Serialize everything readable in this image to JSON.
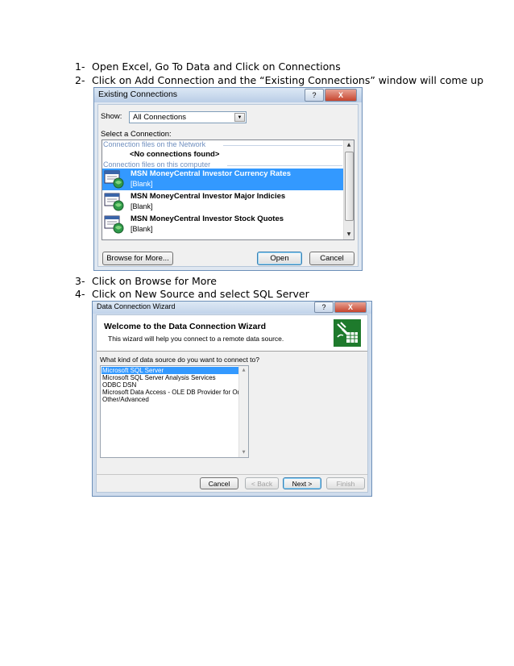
{
  "steps": [
    {
      "num": "1-",
      "text": "Open Excel, Go To Data and Click on Connections"
    },
    {
      "num": "2-",
      "text": "Click on Add Connection and the “Existing Connections” window will come up"
    },
    {
      "num": "3-",
      "text": "Click on Browse for More"
    },
    {
      "num": "4-",
      "text": "Click on New Source and select SQL Server"
    }
  ],
  "existing_connections": {
    "title": "Existing Connections",
    "help_label": "?",
    "close_label": "X",
    "show_label": "Show:",
    "show_value": "All Connections",
    "select_label": "Select a Connection:",
    "section_network": "Connection files on the Network",
    "no_connections": "<No connections found>",
    "section_computer": "Connection files on this computer",
    "items": [
      {
        "name": "MSN MoneyCentral Investor Currency Rates",
        "desc": "[Blank]",
        "selected": true
      },
      {
        "name": "MSN MoneyCentral Investor Major Indicies",
        "desc": "[Blank]",
        "selected": false
      },
      {
        "name": "MSN MoneyCentral Investor Stock Quotes",
        "desc": "[Blank]",
        "selected": false
      }
    ],
    "browse_label": "Browse for More...",
    "open_label": "Open",
    "cancel_label": "Cancel"
  },
  "wizard": {
    "title": "Data Connection Wizard",
    "help_label": "?",
    "close_label": "X",
    "heading": "Welcome to the Data Connection Wizard",
    "subtext": "This wizard will help you connect to a remote data source.",
    "question": "What kind of data source do you want to connect to?",
    "options": [
      {
        "label": "Microsoft SQL Server",
        "selected": true
      },
      {
        "label": "Microsoft SQL Server Analysis Services",
        "selected": false
      },
      {
        "label": "ODBC DSN",
        "selected": false
      },
      {
        "label": "Microsoft Data Access - OLE DB Provider for Oracle",
        "selected": false
      },
      {
        "label": "Other/Advanced",
        "selected": false
      }
    ],
    "cancel_label": "Cancel",
    "back_label": "< Back",
    "next_label": "Next >",
    "finish_label": "Finish"
  }
}
